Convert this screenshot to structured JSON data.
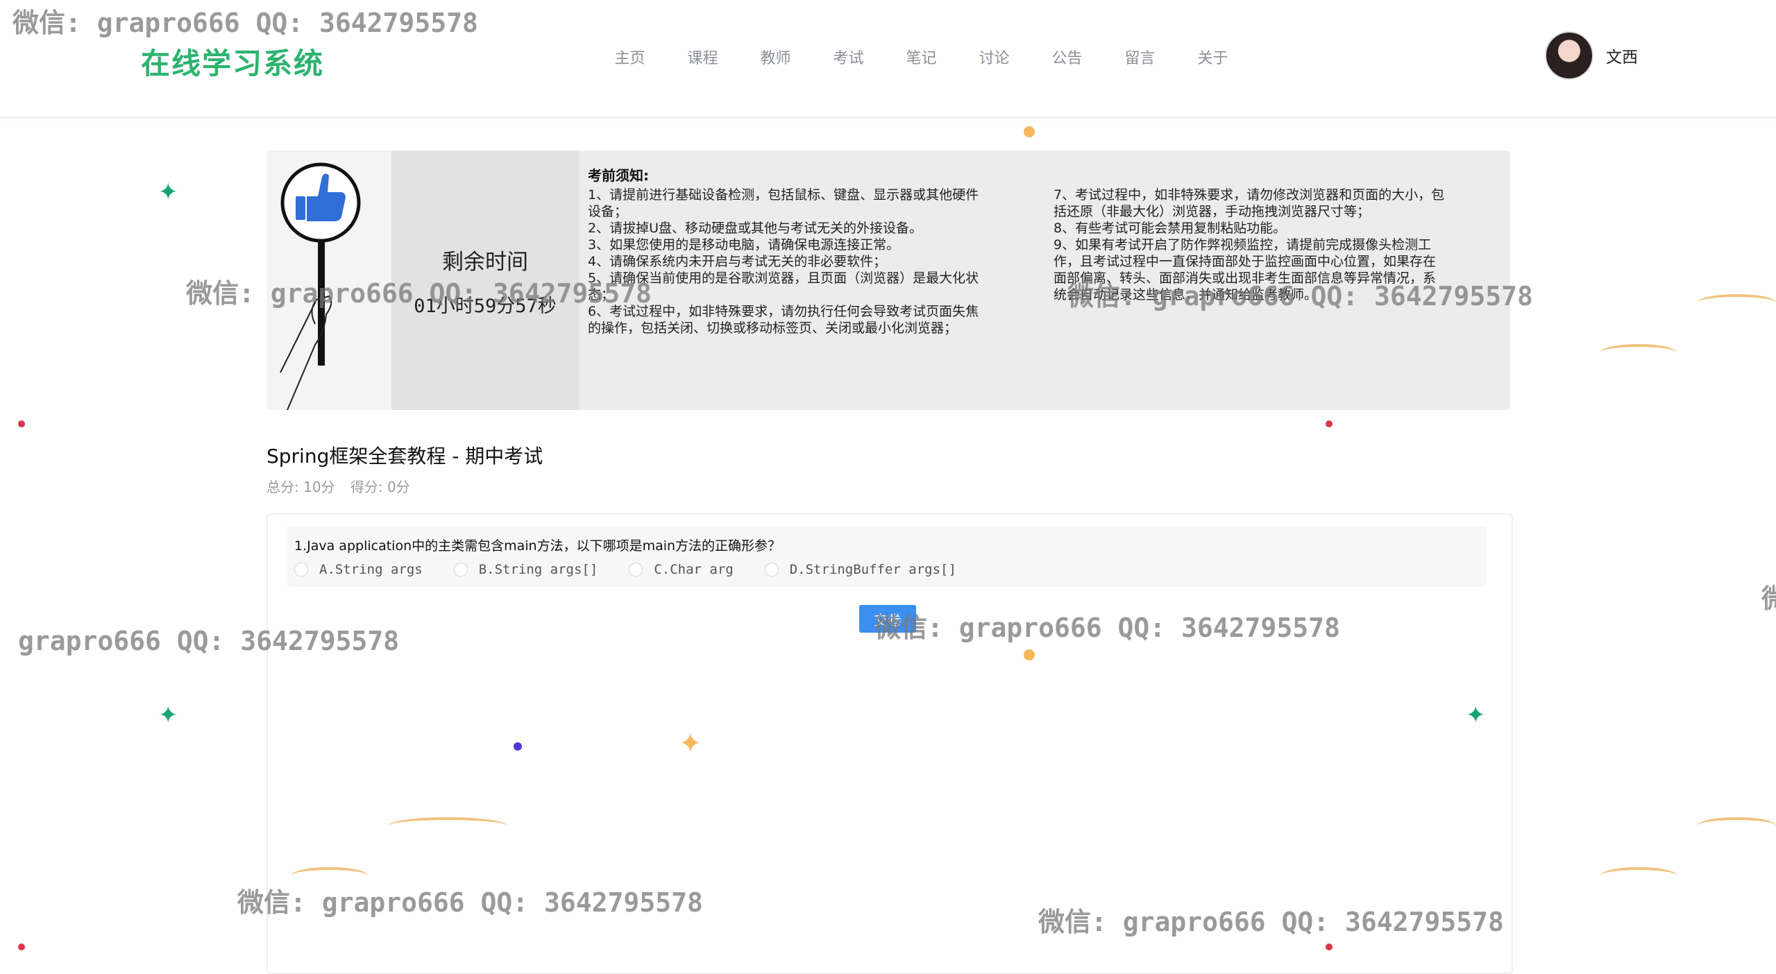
{
  "header": {
    "logo": "在线学习系统",
    "nav": [
      "主页",
      "课程",
      "教师",
      "考试",
      "笔记",
      "讨论",
      "公告",
      "留言",
      "关于"
    ],
    "user": {
      "name": "文西"
    }
  },
  "notice": {
    "timer_label": "剩余时间",
    "timer_value": "01小时59分57秒",
    "title": "考前须知:",
    "rules_left": [
      "1、请提前进行基础设备检测，包括鼠标、键盘、显示器或其他硬件",
      "设备；",
      "2、请拔掉U盘、移动硬盘或其他与考试无关的外接设备。",
      "3、如果您使用的是移动电脑，请确保电源连接正常。",
      "4、请确保系统内未开启与考试无关的非必要软件；",
      "5、请确保当前使用的是谷歌浏览器，且页面（浏览器）是最大化状",
      "态；",
      "6、考试过程中，如非特殊要求，请勿执行任何会导致考试页面失焦",
      "的操作，包括关闭、切换或移动标签页、关闭或最小化浏览器；"
    ],
    "rules_right": [
      "7、考试过程中，如非特殊要求，请勿修改浏览器和页面的大小，包",
      "括还原（非最大化）浏览器，手动拖拽浏览器尺寸等；",
      "8、有些考试可能会禁用复制粘贴功能。",
      "9、如果有考试开启了防作弊视频监控，请提前完成摄像头检测工",
      "作，且考试过程中一直保持面部处于监控画面中心位置，如果存在",
      "面部偏离、转头、面部消失或出现非考生面部信息等异常情况，系",
      "统会自动记录这些信息，并通知给监考教师。"
    ]
  },
  "exam": {
    "title": "Spring框架全套教程 - 期中考试",
    "total": "总分: 10分",
    "score": "得分: 0分"
  },
  "question": {
    "text": "1.Java application中的主类需包含main方法，以下哪项是main方法的正确形参？",
    "options": [
      "A.String args",
      "B.String args[]",
      "C.Char arg",
      "D.StringBuffer args[]"
    ]
  },
  "submit_label": "交卷",
  "watermarks": [
    "微信: grapro666 QQ: 3642795578",
    "微信: grapro666 QQ: 3642795578",
    "微信: grapro666 QQ: 3642795578",
    "微信: grapro666 QQ: 3642795578",
    "grapro666 QQ: 3642795578",
    "微信: grapro666 QQ: 3642795578",
    "微信: grapro666 QQ: 3642795578",
    "微"
  ],
  "colors": {
    "brand": "#2db36f",
    "primary_button": "#3c8ef0",
    "nav_text": "#8b8f96"
  }
}
